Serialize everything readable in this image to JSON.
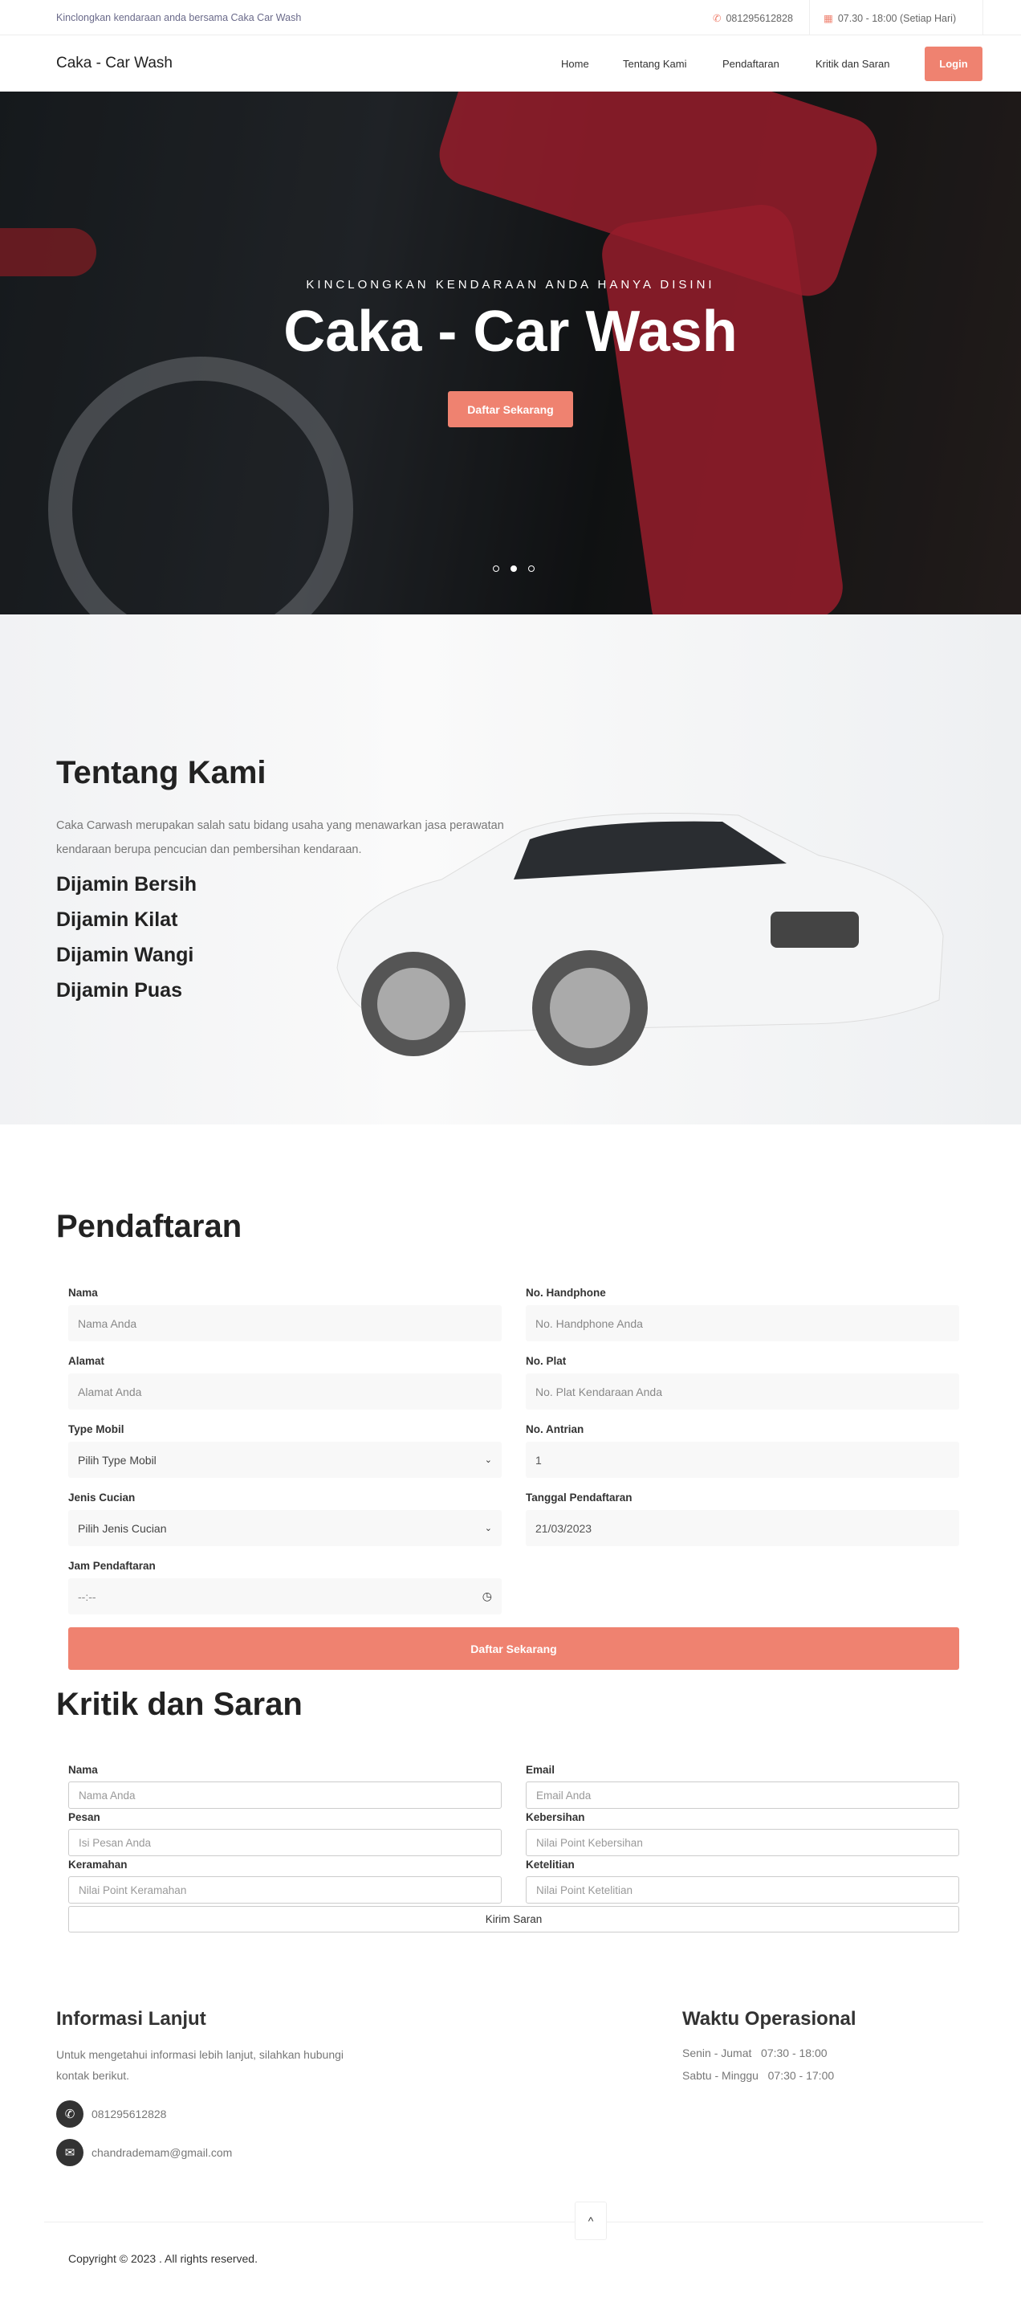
{
  "topbar": {
    "tagline": "Kinclongkan kendaraan anda bersama Caka Car Wash",
    "phone": "081295612828",
    "hours": "07.30 - 18:00 (Setiap Hari)",
    "phone_icon": "phone-icon",
    "calendar_icon": "calendar-icon"
  },
  "nav": {
    "brand": "Caka - Car Wash",
    "links": [
      "Home",
      "Tentang Kami",
      "Pendaftaran",
      "Kritik dan Saran"
    ],
    "login": "Login"
  },
  "hero": {
    "subtitle": "KINCLONGKAN KENDARAAN ANDA HANYA DISINI",
    "title": "Caka - Car Wash",
    "button": "Daftar Sekarang",
    "slides": 3,
    "active_slide": 2
  },
  "about": {
    "title": "Tentang Kami",
    "text": "Caka Carwash merupakan salah satu bidang usaha yang menawarkan jasa perawatan kendaraan berupa pencucian dan pembersihan kendaraan.",
    "features": [
      "Dijamin Bersih",
      "Dijamin Kilat",
      "Dijamin Wangi",
      "Dijamin Puas"
    ]
  },
  "registration": {
    "title": "Pendaftaran",
    "fields": [
      {
        "label": "Nama",
        "placeholder": "Nama Anda"
      },
      {
        "label": "No. Handphone",
        "placeholder": "No. Handphone Anda"
      },
      {
        "label": "Alamat",
        "placeholder": "Alamat Anda"
      },
      {
        "label": "No. Plat",
        "placeholder": "No. Plat Kendaraan Anda"
      },
      {
        "label": "Type Mobil",
        "value": "Pilih Type Mobil"
      },
      {
        "label": "No. Antrian",
        "value": "1"
      },
      {
        "label": "Jenis Cucian",
        "value": "Pilih Jenis Cucian"
      },
      {
        "label": "Tanggal Pendaftaran",
        "value": "21/03/2023"
      },
      {
        "label": "Jam Pendaftaran",
        "value": "--:--"
      }
    ],
    "submit": "Daftar Sekarang"
  },
  "feedback": {
    "title": "Kritik dan Saran",
    "fields": [
      {
        "label": "Nama",
        "placeholder": "Nama Anda"
      },
      {
        "label": "Email",
        "placeholder": "Email Anda"
      },
      {
        "label": "Pesan",
        "placeholder": "Isi Pesan Anda"
      },
      {
        "label": "Kebersihan",
        "placeholder": "Nilai Point Kebersihan"
      },
      {
        "label": "Keramahan",
        "placeholder": "Nilai Point Keramahan"
      },
      {
        "label": "Ketelitian",
        "placeholder": "Nilai Point Ketelitian"
      }
    ],
    "submit": "Kirim Saran"
  },
  "footer": {
    "info_title": "Informasi Lanjut",
    "info_text": "Untuk mengetahui informasi lebih lanjut, silahkan hubungi kontak berikut.",
    "phone": "081295612828",
    "email": "chandrademam@gmail.com",
    "hours_title": "Waktu Operasional",
    "hours": [
      {
        "days": "Senin - Jumat",
        "time": "07:30 - 18:00"
      },
      {
        "days": "Sabtu - Minggu",
        "time": "07:30 - 17:00"
      }
    ],
    "copyright": "Copyright © 2023 . All rights reserved."
  },
  "colors": {
    "accent": "#ef8270",
    "dark": "#333333"
  }
}
